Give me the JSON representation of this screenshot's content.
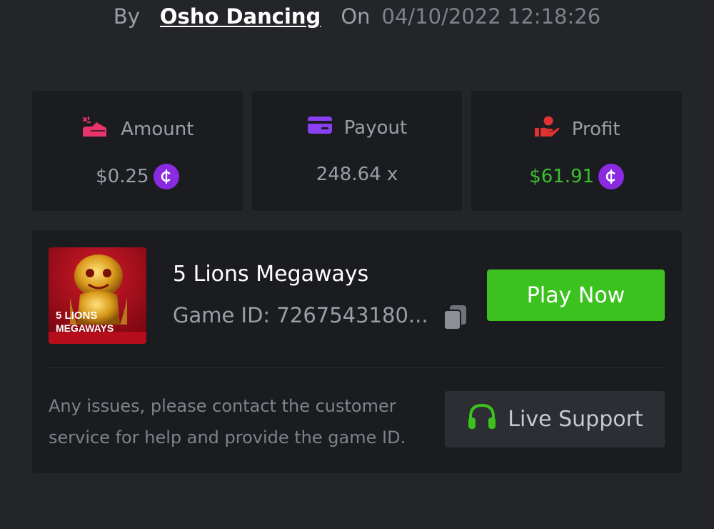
{
  "header": {
    "by_label": "By",
    "username": "Osho Dancing",
    "on_label": "On",
    "datetime": "04/10/2022 12:18:26"
  },
  "stats": {
    "amount": {
      "label": "Amount",
      "value": "$0.25",
      "icon": "amount-icon"
    },
    "payout": {
      "label": "Payout",
      "value": "248.64 x",
      "icon": "card-icon"
    },
    "profit": {
      "label": "Profit",
      "value": "$61.91",
      "icon": "hand-coin-icon"
    }
  },
  "game": {
    "title": "5 Lions Megaways",
    "id_text": "Game ID: 7267543180...",
    "thumbnail_text_1": "5 LIONS",
    "thumbnail_text_2": "MEGAWAYS",
    "play_label": "Play Now"
  },
  "support": {
    "help_text": "Any issues, please contact the customer service for help and provide the game ID.",
    "button_label": "Live Support",
    "icon": "headset-icon"
  },
  "colors": {
    "background": "#232529",
    "card": "#1b1c20",
    "accent_green": "#3cc21e",
    "profit_green": "#39c22e",
    "coin_purple": "#8a2be2",
    "amount_pink": "#e8336b",
    "payout_purple": "#8b3ff2",
    "profit_red": "#e03232"
  }
}
